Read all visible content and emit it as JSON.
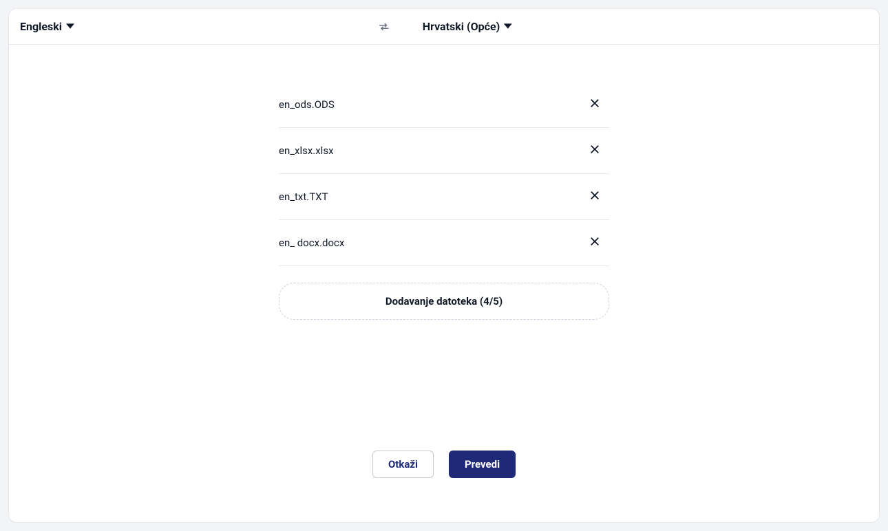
{
  "languages": {
    "source": "Engleski",
    "target": "Hrvatski (Opće)"
  },
  "files": [
    {
      "name": "en_ods.ODS"
    },
    {
      "name": "en_xlsx.xlsx"
    },
    {
      "name": "en_txt.TXT"
    },
    {
      "name": "en_ docx.docx"
    }
  ],
  "add_files_label": "Dodavanje datoteka (4/5)",
  "actions": {
    "cancel": "Otkaži",
    "translate": "Prevedi"
  }
}
